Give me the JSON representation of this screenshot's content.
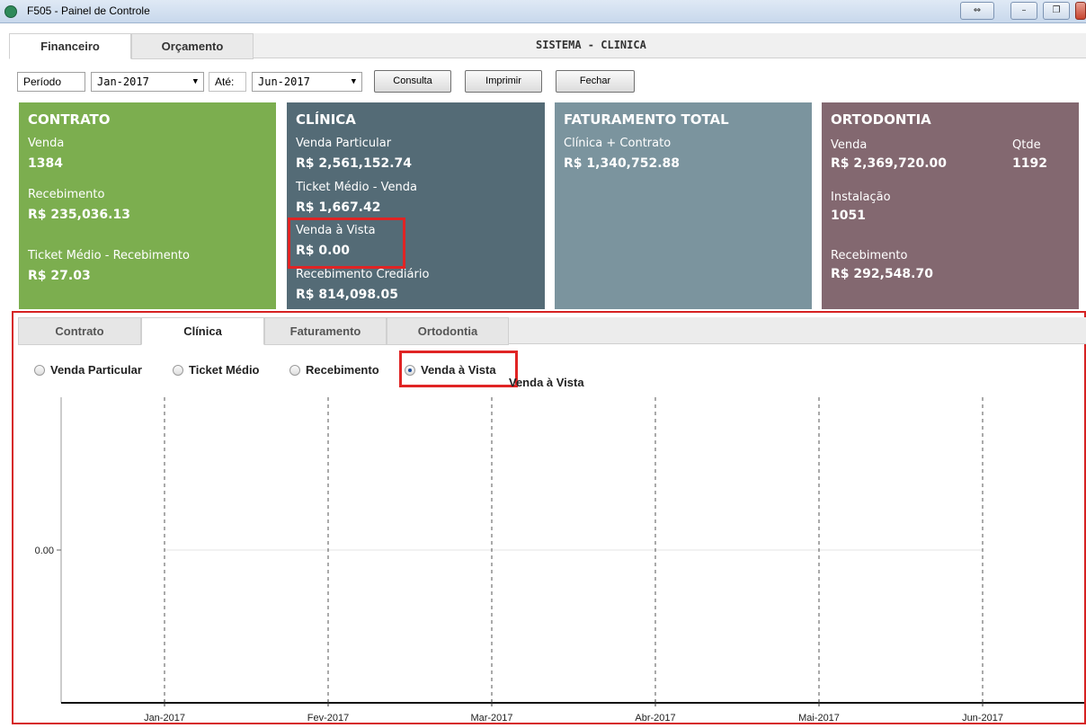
{
  "window": {
    "title": "F505 - Painel de Controle",
    "buttons": {
      "resize": "⇔",
      "minimize": "–",
      "restore": "❐",
      "close": ""
    }
  },
  "main_tabs": [
    {
      "label": "Financeiro",
      "active": true
    },
    {
      "label": "Orçamento",
      "active": false
    }
  ],
  "system_title": "SISTEMA - CLINICA",
  "filters": {
    "period_label": "Período",
    "from_value": "Jan-2017",
    "to_label": "Até:",
    "to_value": "Jun-2017",
    "buttons": {
      "consulta": "Consulta",
      "imprimir": "Imprimir",
      "fechar": "Fechar"
    }
  },
  "cards": {
    "contrato": {
      "title": "CONTRATO",
      "color": "#7cae4f",
      "venda_label": "Venda",
      "venda_value": "1384",
      "recebimento_label": "Recebimento",
      "recebimento_value": "R$ 235,036.13",
      "ticket_label": "Ticket Médio - Recebimento",
      "ticket_value": "R$ 27.03"
    },
    "clinica": {
      "title": "CLÍNICA",
      "color": "#546b76",
      "venda_particular_label": "Venda Particular",
      "venda_particular_value": "R$ 2,561,152.74",
      "ticket_label": "Ticket Médio - Venda",
      "ticket_value": "R$ 1,667.42",
      "vista_label": "Venda à Vista",
      "vista_value": "R$ 0.00",
      "crediario_label": "Recebimento Crediário",
      "crediario_value": "R$ 814,098.05"
    },
    "faturamento": {
      "title": "FATURAMENTO TOTAL",
      "color": "#7b949e",
      "label": "Clínica + Contrato",
      "value": "R$ 1,340,752.88"
    },
    "ortodontia": {
      "title": "ORTODONTIA",
      "color": "#836870",
      "venda_label": "Venda",
      "venda_value": "R$ 2,369,720.00",
      "qtde_label": "Qtde",
      "qtde_value": "1192",
      "instalacao_label": "Instalação",
      "instalacao_value": "1051",
      "recebimento_label": "Recebimento",
      "recebimento_value": "R$ 292,548.70"
    }
  },
  "sub_tabs": [
    {
      "label": "Contrato",
      "active": false
    },
    {
      "label": "Clínica",
      "active": true
    },
    {
      "label": "Faturamento",
      "active": false
    },
    {
      "label": "Ortodontia",
      "active": false
    }
  ],
  "radios": [
    {
      "label": "Venda Particular",
      "checked": false
    },
    {
      "label": "Ticket Médio",
      "checked": false
    },
    {
      "label": "Recebimento",
      "checked": false
    },
    {
      "label": "Venda à Vista",
      "checked": true
    }
  ],
  "highlight_color": "#e02424",
  "chart_data": {
    "type": "line",
    "title": "Venda à Vista",
    "categories": [
      "Jan-2017",
      "Fev-2017",
      "Mar-2017",
      "Abr-2017",
      "Mai-2017",
      "Jun-2017"
    ],
    "series": [
      {
        "values": [
          0,
          0,
          0,
          0,
          0,
          0
        ]
      }
    ],
    "y_tick_labels": [
      "0.00"
    ],
    "grid": "vertical dashed",
    "xlabel": "",
    "ylabel": ""
  }
}
